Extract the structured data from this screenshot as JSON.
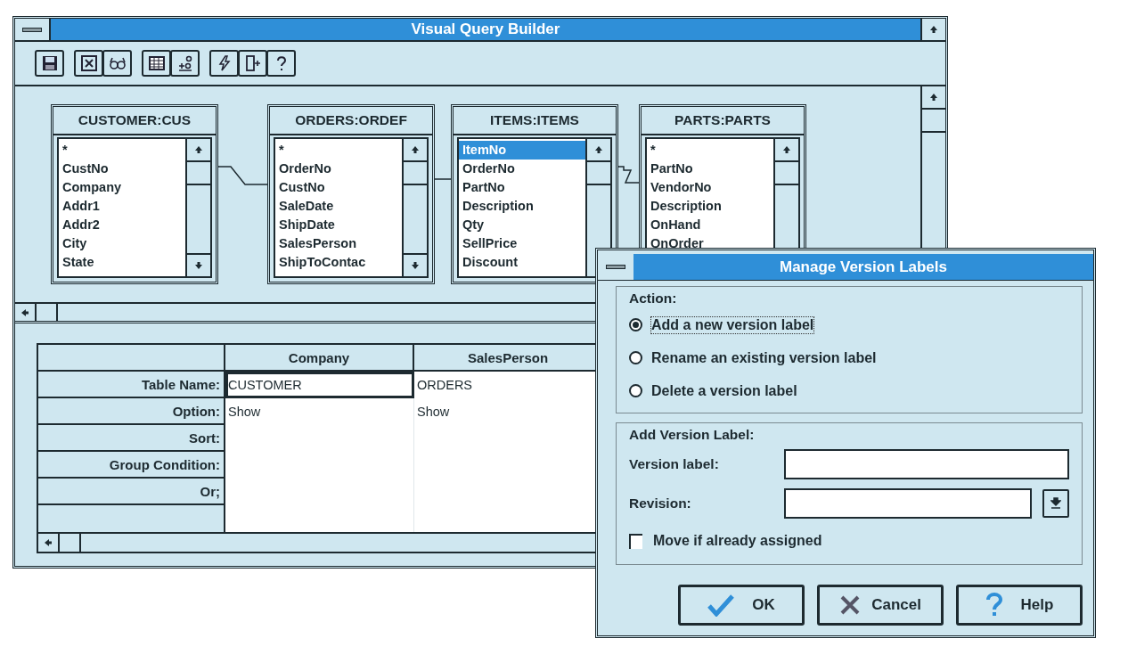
{
  "window": {
    "title": "Visual Query Builder"
  },
  "tables": [
    {
      "title": "CUSTOMER:CUS",
      "fields": [
        {
          "name": "*",
          "selected": false
        },
        {
          "name": "CustNo",
          "selected": false
        },
        {
          "name": "Company",
          "selected": false
        },
        {
          "name": "Addr1",
          "selected": false
        },
        {
          "name": "Addr2",
          "selected": false
        },
        {
          "name": "City",
          "selected": false
        },
        {
          "name": "State",
          "selected": false
        }
      ]
    },
    {
      "title": "ORDERS:ORDEF",
      "fields": [
        {
          "name": "*",
          "selected": false
        },
        {
          "name": "OrderNo",
          "selected": false
        },
        {
          "name": "CustNo",
          "selected": false
        },
        {
          "name": "SaleDate",
          "selected": false
        },
        {
          "name": "ShipDate",
          "selected": false
        },
        {
          "name": "SalesPerson",
          "selected": false
        },
        {
          "name": "ShipToContac",
          "selected": false
        }
      ]
    },
    {
      "title": "ITEMS:ITEMS",
      "fields": [
        {
          "name": "ItemNo",
          "selected": true
        },
        {
          "name": "OrderNo",
          "selected": false
        },
        {
          "name": "PartNo",
          "selected": false
        },
        {
          "name": "Description",
          "selected": false
        },
        {
          "name": "Qty",
          "selected": false
        },
        {
          "name": "SellPrice",
          "selected": false
        },
        {
          "name": "Discount",
          "selected": false
        }
      ]
    },
    {
      "title": "PARTS:PARTS",
      "fields": [
        {
          "name": "*",
          "selected": false
        },
        {
          "name": "PartNo",
          "selected": false
        },
        {
          "name": "VendorNo",
          "selected": false
        },
        {
          "name": "Description",
          "selected": false
        },
        {
          "name": "OnHand",
          "selected": false
        },
        {
          "name": "OnOrder",
          "selected": false
        }
      ]
    }
  ],
  "grid": {
    "columns": [
      "Company",
      "SalesPerson"
    ],
    "rows": [
      {
        "label": "Table Name:",
        "cells": [
          {
            "text": "CUSTOMER",
            "selected": true
          },
          {
            "text": "ORDERS",
            "selected": false
          }
        ]
      },
      {
        "label": "Option:",
        "cells": [
          {
            "text": "Show",
            "selected": false
          },
          {
            "text": "Show",
            "selected": false
          }
        ]
      },
      {
        "label": "Sort:"
      },
      {
        "label": "Group Condition:"
      },
      {
        "label": "Or;"
      }
    ]
  },
  "dialog": {
    "title": "Manage Version Labels",
    "action_group": {
      "label": "Action:",
      "options": [
        {
          "label": "Add a new version label",
          "selected": true
        },
        {
          "label": "Rename an existing version label",
          "selected": false
        },
        {
          "label": "Delete a version label",
          "selected": false
        }
      ]
    },
    "add_group": {
      "label": "Add Version Label:",
      "fields": [
        {
          "label": "Version label:",
          "kind": "text"
        },
        {
          "label": "Revision:",
          "kind": "dropdown"
        }
      ],
      "checkbox": {
        "label": "Move if already assigned",
        "checked": false
      }
    },
    "buttons": [
      {
        "label": "OK",
        "kind": "ok"
      },
      {
        "label": "Cancel",
        "kind": "cancel"
      },
      {
        "label": "Help",
        "kind": "help"
      }
    ]
  }
}
